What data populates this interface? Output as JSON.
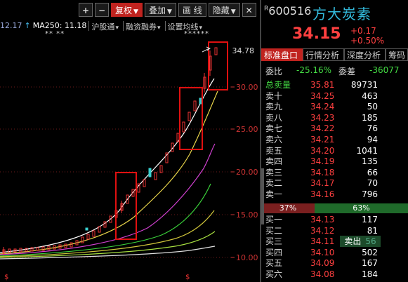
{
  "toolbar": {
    "plus": "+",
    "minus": "−",
    "fuquan": "复权",
    "diejia": "叠加",
    "huaxian": "画 线",
    "yincang": "隐藏",
    "close": "✕"
  },
  "ma_row": {
    "ma_value": "12.17",
    "ma250_label": "MA250: 11.18",
    "tabs": [
      "沪股通",
      "融资融券",
      "设置均线"
    ]
  },
  "markers": {
    "left": "** **",
    "right": "******"
  },
  "chart": {
    "peak_label": "34.78",
    "axis_labels": [
      "30.00",
      "25.00",
      "20.00",
      "15.00",
      "10.00"
    ],
    "dollar_signs": [
      "$",
      "$"
    ]
  },
  "quote": {
    "code_prefix": "R",
    "code": "600516",
    "name": "方大炭素",
    "price": "34.15",
    "change": "+0.17",
    "change_pct": "+0.50%",
    "up_color": "#ff4040"
  },
  "tabs": [
    "标准盘口",
    "行情分析",
    "深度分析",
    "筹码"
  ],
  "ratio": {
    "wb_label": "委比",
    "wb_value": "-25.16%",
    "wc_label": "委差",
    "wc_value": "-36077"
  },
  "sell_orders": [
    {
      "label": "总卖量",
      "price": "35.81",
      "volume": "89731"
    },
    {
      "label": "卖十",
      "price": "34.25",
      "volume": "463"
    },
    {
      "label": "卖九",
      "price": "34.24",
      "volume": "50"
    },
    {
      "label": "卖八",
      "price": "34.23",
      "volume": "185"
    },
    {
      "label": "卖七",
      "price": "34.22",
      "volume": "76"
    },
    {
      "label": "卖六",
      "price": "34.21",
      "volume": "94"
    },
    {
      "label": "卖五",
      "price": "34.20",
      "volume": "1041"
    },
    {
      "label": "卖四",
      "price": "34.19",
      "volume": "135"
    },
    {
      "label": "卖三",
      "price": "34.18",
      "volume": "66"
    },
    {
      "label": "卖二",
      "price": "34.17",
      "volume": "70"
    },
    {
      "label": "卖一",
      "price": "34.16",
      "volume": "796"
    }
  ],
  "ratio_bar": {
    "sell_pct": "37%",
    "buy_pct": "63%"
  },
  "buy_orders": [
    {
      "label": "买一",
      "price": "34.13",
      "volume": "117"
    },
    {
      "label": "买二",
      "price": "34.12",
      "volume": "81"
    },
    {
      "label": "买三",
      "price": "34.11",
      "volume": "56"
    },
    {
      "label": "买四",
      "price": "34.10",
      "volume": "502"
    },
    {
      "label": "买五",
      "price": "34.09",
      "volume": "167"
    },
    {
      "label": "买六",
      "price": "34.08",
      "volume": "184"
    }
  ],
  "popup": {
    "label": "卖出",
    "ghost": "56"
  }
}
